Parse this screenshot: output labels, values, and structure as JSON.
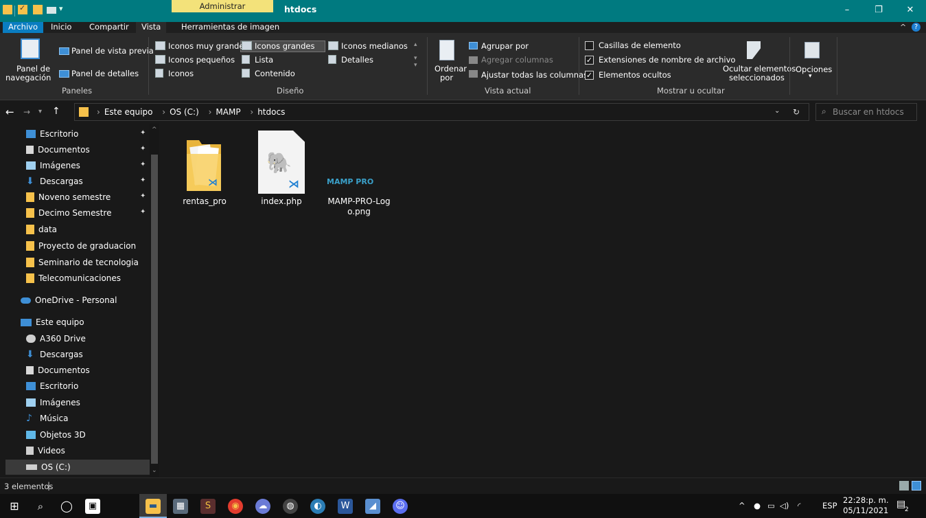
{
  "titlebar": {
    "context_tab": "Administrar",
    "title": "htdocs",
    "minimize": "–",
    "maximize": "❐",
    "close": "✕"
  },
  "tabs": [
    "Archivo",
    "Inicio",
    "Compartir",
    "Vista",
    "Herramientas de imagen"
  ],
  "ribbon": {
    "panes": {
      "nav_pane": "Panel de",
      "nav_pane2": "navegación",
      "preview": "Panel de vista previa",
      "details": "Panel de detalles",
      "group": "Paneles"
    },
    "layout": {
      "xl": "Iconos muy grandes",
      "large": "Iconos grandes",
      "medium": "Iconos medianos",
      "small": "Iconos pequeños",
      "list": "Lista",
      "details": "Detalles",
      "icons": "Iconos",
      "content": "Contenido",
      "group": "Diseño"
    },
    "current": {
      "sort": "Ordenar",
      "sort2": "por",
      "group_by": "Agrupar por",
      "add_cols": "Agregar columnas",
      "fit_cols": "Ajustar todas las columnas",
      "group": "Vista actual"
    },
    "showhide": {
      "checkboxes": "Casillas de elemento",
      "extensions": "Extensiones de nombre de archivo",
      "hidden": "Elementos ocultos",
      "hide_sel": "Ocultar elementos",
      "hide_sel2": "seleccionados",
      "group": "Mostrar u ocultar"
    },
    "options": "Opciones"
  },
  "address": {
    "crumbs": [
      "Este equipo",
      "OS (C:)",
      "MAMP",
      "htdocs"
    ],
    "search_placeholder": "Buscar en htdocs"
  },
  "nav": {
    "quick": [
      {
        "label": "Escritorio",
        "color": "#3e8fd6",
        "pinned": true
      },
      {
        "label": "Documentos",
        "color": "#d8d8d8",
        "pinned": true
      },
      {
        "label": "Imágenes",
        "color": "#9fd0f0",
        "pinned": true
      },
      {
        "label": "Descargas",
        "color": "#3e8fd6",
        "pinned": true
      },
      {
        "label": "Noveno semestre",
        "color": "#f6c14b",
        "pinned": true
      },
      {
        "label": "Decimo Semestre",
        "color": "#f6c14b",
        "pinned": true
      },
      {
        "label": "data",
        "color": "#f6c14b",
        "pinned": false
      },
      {
        "label": "Proyecto de graduacion",
        "color": "#f6c14b",
        "pinned": false
      },
      {
        "label": "Seminario de tecnologia",
        "color": "#f6c14b",
        "pinned": false
      },
      {
        "label": "Telecomunicaciones",
        "color": "#f6c14b",
        "pinned": false
      }
    ],
    "onedrive": "OneDrive - Personal",
    "this_pc": "Este equipo",
    "pc_items": [
      {
        "label": "A360 Drive",
        "color": "#cfcfcf"
      },
      {
        "label": "Descargas",
        "color": "#3e8fd6"
      },
      {
        "label": "Documentos",
        "color": "#d8d8d8"
      },
      {
        "label": "Escritorio",
        "color": "#3e8fd6"
      },
      {
        "label": "Imágenes",
        "color": "#9fd0f0"
      },
      {
        "label": "Música",
        "color": "#3e8fd6"
      },
      {
        "label": "Objetos 3D",
        "color": "#5fb8e8"
      },
      {
        "label": "Videos",
        "color": "#cfcfcf"
      },
      {
        "label": "OS (C:)",
        "color": "#cfcfcf"
      }
    ]
  },
  "files": [
    {
      "name": "rentas_pro",
      "type": "folder"
    },
    {
      "name": "index.php",
      "type": "php"
    },
    {
      "name": "MAMP-PRO-Log",
      "name2": "o.png",
      "type": "png",
      "logo_text": "MAMP PRO"
    }
  ],
  "status": {
    "count": "3 elementos"
  },
  "taskbar": {
    "lang": "ESP",
    "time": "22:28:p. m.",
    "date": "05/11/2021",
    "notif_count": "2"
  }
}
